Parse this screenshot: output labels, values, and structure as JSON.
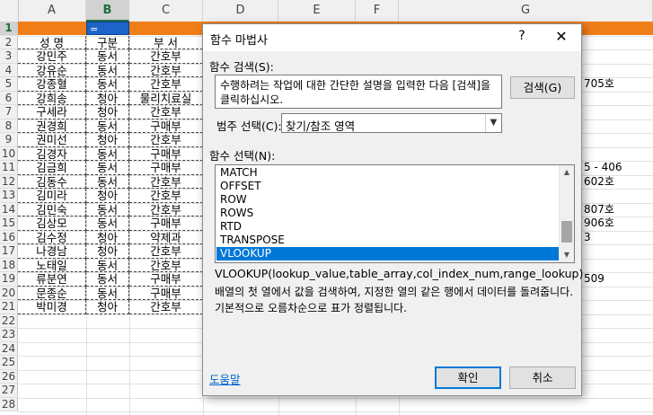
{
  "sheet": {
    "columns": [
      "A",
      "B",
      "C",
      "D",
      "E",
      "F",
      "G"
    ],
    "row_numbers": [
      "1",
      "2",
      "3",
      "4",
      "5",
      "6",
      "7",
      "8",
      "9",
      "10",
      "11",
      "12",
      "13",
      "14",
      "15",
      "16",
      "17",
      "18",
      "19",
      "20",
      "21",
      "22",
      "23",
      "24",
      "25",
      "26",
      "27",
      "28"
    ],
    "b1_value": "=",
    "header_row": [
      "성  명",
      "구분",
      "부  서"
    ],
    "rows": [
      [
        "강민주",
        "동서",
        "간호부"
      ],
      [
        "강유순",
        "동서",
        "간호부"
      ],
      [
        "강종혈",
        "동서",
        "간호부"
      ],
      [
        "강희송",
        "청아",
        "물리치료실"
      ],
      [
        "구세라",
        "청아",
        "간호부"
      ],
      [
        "권경희",
        "동서",
        "구매부"
      ],
      [
        "권미선",
        "청아",
        "간호부"
      ],
      [
        "김경자",
        "동서",
        "구매부"
      ],
      [
        "김금희",
        "동서",
        "구매부"
      ],
      [
        "김동수",
        "동서",
        "간호부"
      ],
      [
        "김미라",
        "청아",
        "간호부"
      ],
      [
        "김민숙",
        "동서",
        "간호부"
      ],
      [
        "김상모",
        "동서",
        "구매부"
      ],
      [
        "김수정",
        "청아",
        "약제과"
      ],
      [
        "나경남",
        "청아",
        "간호부"
      ],
      [
        "노태일",
        "동서",
        "간호부"
      ],
      [
        "류분연",
        "동서",
        "구매부"
      ],
      [
        "문종순",
        "동서",
        "구매부"
      ],
      [
        "박미경",
        "청아",
        "간호부"
      ]
    ],
    "g_fragments": [
      {
        "row": 5,
        "text": "705호"
      },
      {
        "row": 11,
        "text": "5 - 406"
      },
      {
        "row": 12,
        "text": "602호"
      },
      {
        "row": 14,
        "text": "807호"
      },
      {
        "row": 15,
        "text": "906호"
      },
      {
        "row": 16,
        "text": "3"
      },
      {
        "row": 19,
        "text": "509"
      }
    ],
    "accent_orange": "#f07e18",
    "accent_blue": "#1e64c8"
  },
  "dialog": {
    "title": "함수 마법사",
    "help_glyph": "?",
    "close_glyph": "✕",
    "search_label": "함수 검색(S):",
    "search_text": "수행하려는 작업에 대한 간단한 설명을 입력한 다음 [검색]을 클릭하십시오.",
    "search_button": "검색(G)",
    "category_label": "범주 선택(C):",
    "category_value": "찾기/참조 영역",
    "function_label": "함수 선택(N):",
    "functions": [
      "MATCH",
      "OFFSET",
      "ROW",
      "ROWS",
      "RTD",
      "TRANSPOSE",
      "VLOOKUP"
    ],
    "selected_function": "VLOOKUP",
    "signature": "VLOOKUP(lookup_value,table_array,col_index_num,range_lookup)",
    "description": "배열의 첫 열에서 값을 검색하여, 지정한 열의 같은 행에서 데이터를 돌려줍니다. 기본적으로 오름차순으로 표가 정렬됩니다.",
    "help_link": "도움말",
    "ok_button": "확인",
    "cancel_button": "취소"
  }
}
